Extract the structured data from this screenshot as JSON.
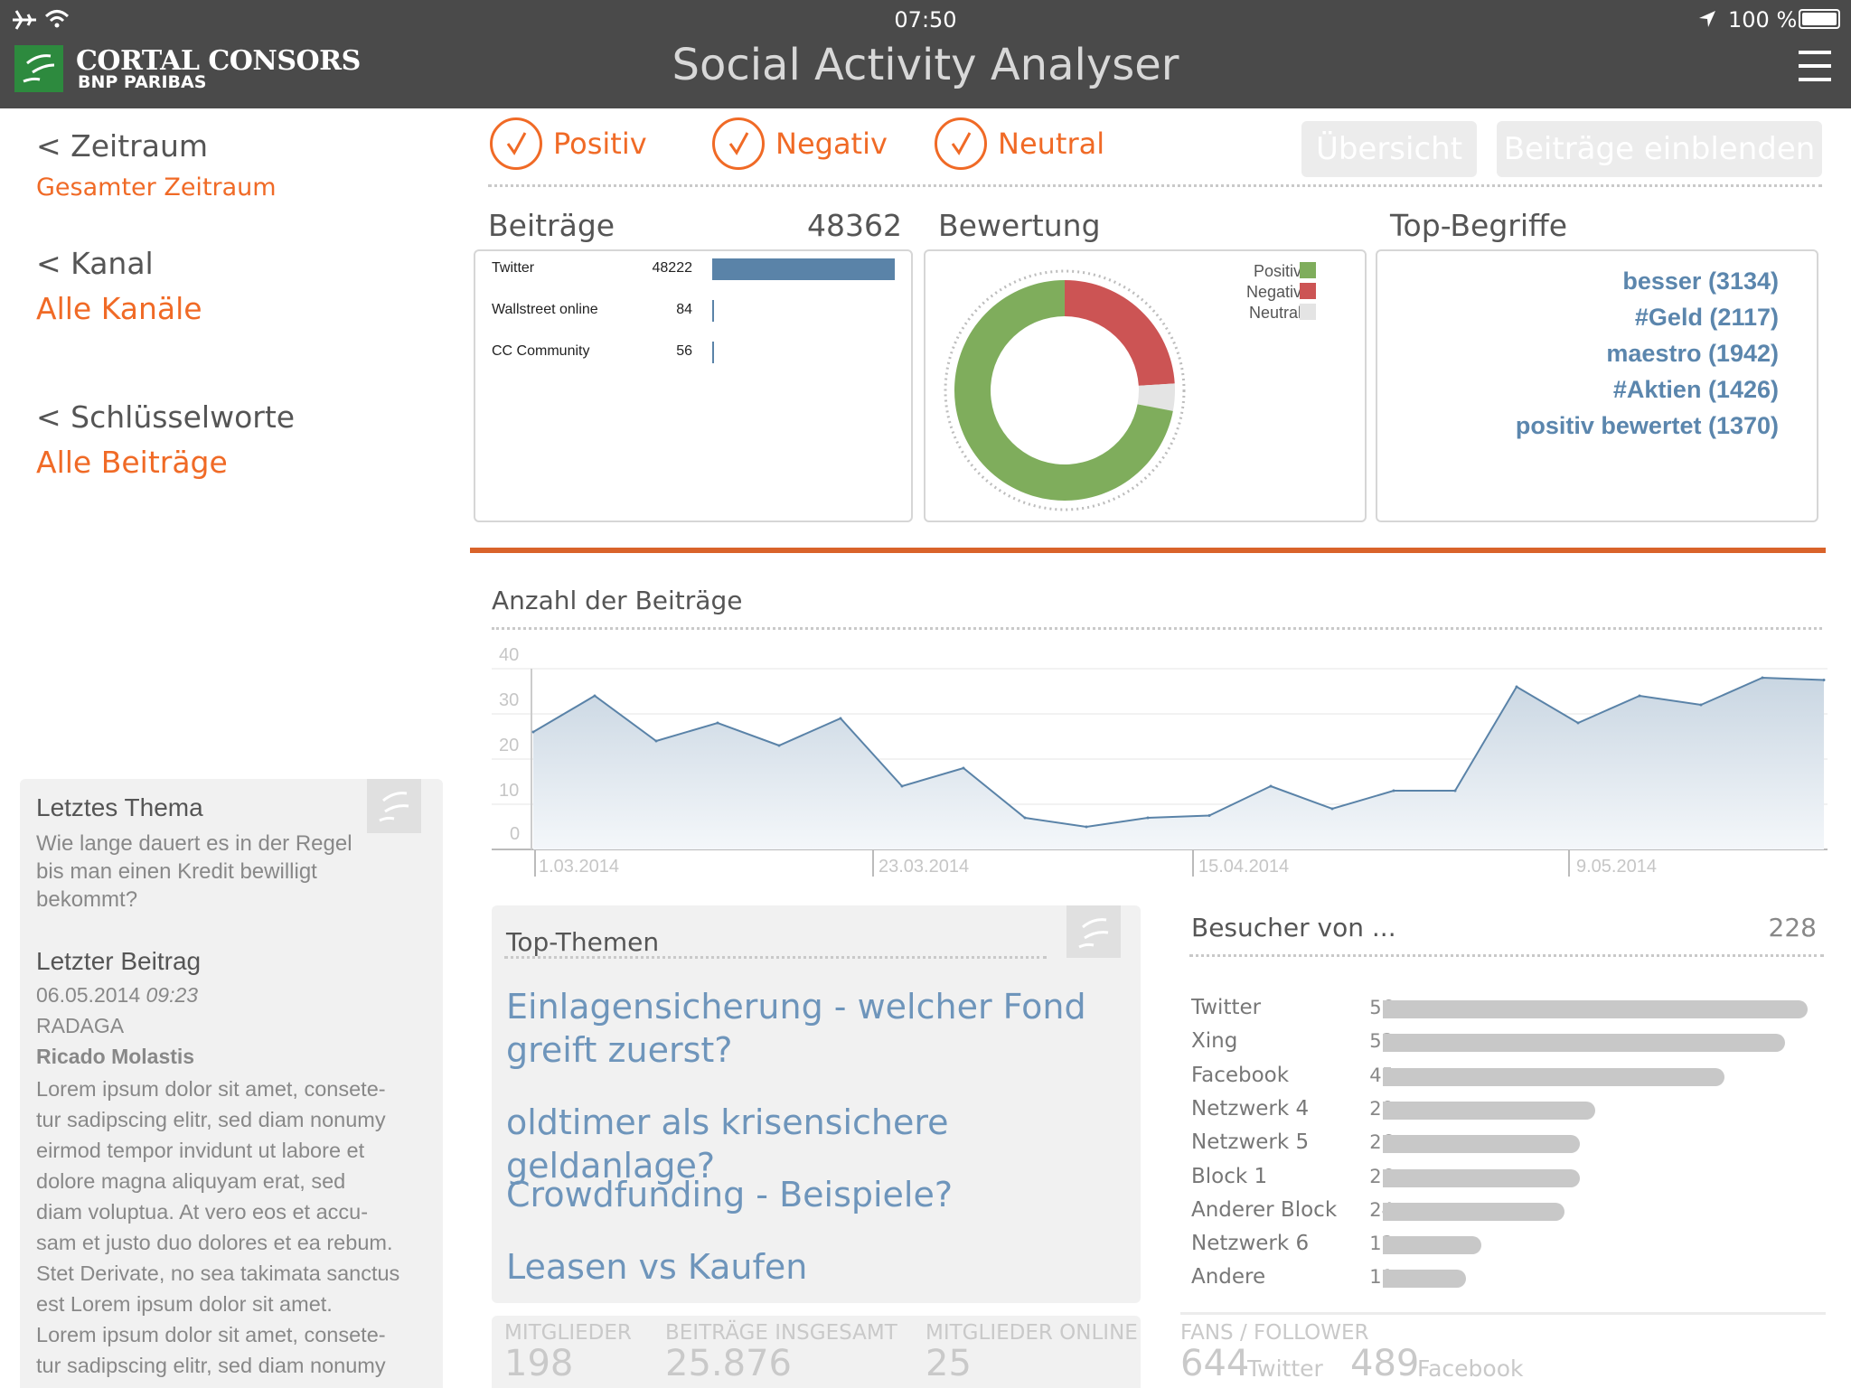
{
  "status": {
    "time": "07:50",
    "battery": "100 %"
  },
  "app": {
    "title": "Social Activity Analyser",
    "brand_line1": "CORTAL CONSORS",
    "brand_line2": "BNP PARIBAS"
  },
  "nav": {
    "zeitraum_label": "< Zeitraum",
    "zeitraum_value": "Gesamter Zeitraum",
    "kanal_label": "< Kanal",
    "kanal_value": "Alle Kanäle",
    "schluessel_label": "< Schlüsselworte",
    "schluessel_value": "Alle Beiträge"
  },
  "side_card": {
    "last_topic_title": "Letztes Thema",
    "last_topic_line1": "Wie lange dauert es in der Regel",
    "last_topic_line2": "bis man einen Kredit bewilligt",
    "last_topic_line3": "bekommt?",
    "last_post_title": "Letzter Beitrag",
    "last_post_date": "06.05.2014",
    "last_post_time": "09:23",
    "last_post_source": "RADAGA",
    "last_post_author": "Ricado Molastis",
    "body_lines": [
      "Lorem ipsum dolor sit amet, consete-",
      "tur sadipscing elitr, sed diam nonumy",
      "eirmod tempor invidunt ut labore et",
      "dolore magna aliquyam erat, sed",
      "diam voluptua. At vero eos et accu-",
      "sam et justo duo dolores et ea rebum.",
      "Stet Derivate, no sea takimata sanctus",
      "est Lorem ipsum dolor sit amet.",
      "Lorem ipsum dolor sit amet, consete-",
      "tur sadipscing elitr, sed diam nonumy"
    ]
  },
  "filters": {
    "positiv": "Positiv",
    "negativ": "Negativ",
    "neutral": "Neutral",
    "overview_button": "Übersicht",
    "show_posts_button": "Beiträge einblenden"
  },
  "beitraege": {
    "title": "Beiträge",
    "total": "48362",
    "rows": [
      {
        "label": "Twitter",
        "value": "48222",
        "fraction": 1.0
      },
      {
        "label": "Wallstreet online",
        "value": "84",
        "fraction": 0.002
      },
      {
        "label": "CC Community",
        "value": "56",
        "fraction": 0.001
      }
    ]
  },
  "bewertung": {
    "title": "Bewertung",
    "legend": [
      {
        "label": "Positiv",
        "color": "#7fad5c"
      },
      {
        "label": "Negativ",
        "color": "#cc5454"
      },
      {
        "label": "Neutral",
        "color": "#e4e4e4"
      }
    ],
    "shares": {
      "positiv": 0.72,
      "negativ": 0.24,
      "neutral": 0.04
    }
  },
  "top_begriffe": {
    "title": "Top-Begriffe",
    "items": [
      "besser (3134)",
      "#Geld (2117)",
      "maestro (1942)",
      "#Aktien (1426)",
      "positiv bewertet (1370)"
    ]
  },
  "chart_data": {
    "type": "area",
    "title": "Anzahl der Beiträge",
    "ylim": [
      0,
      40
    ],
    "yticks": [
      "40",
      "30",
      "20",
      "10",
      "0"
    ],
    "xtick_labels": [
      "1.03.2014",
      "23.03.2014",
      "15.04.2014",
      "9.05.2014"
    ],
    "values": [
      26,
      34,
      24,
      28,
      23,
      29,
      14,
      18,
      7,
      5,
      7,
      7.5,
      14,
      9,
      13,
      13,
      36,
      28,
      34,
      32,
      38,
      37.5
    ],
    "color": "#5a83a8"
  },
  "top_themen": {
    "title": "Top-Themen",
    "items": [
      "Einlagensicherung - welcher Fond greift zuerst?",
      "oldtimer als krisensichere geldanlage?",
      "Crowdfunding - Beispiele?",
      "Leasen vs Kaufen"
    ]
  },
  "besucher": {
    "title": "Besucher von ...",
    "total": "228",
    "rows": [
      {
        "label": "Twitter",
        "value": "56"
      },
      {
        "label": "Xing",
        "value": "53"
      },
      {
        "label": "Facebook",
        "value": "45"
      },
      {
        "label": "Netzwerk 4",
        "value": "28"
      },
      {
        "label": "Netzwerk 5",
        "value": "26"
      },
      {
        "label": "Block 1",
        "value": "26"
      },
      {
        "label": "Anderer Block",
        "value": "24"
      },
      {
        "label": "Netzwerk 6",
        "value": "13"
      },
      {
        "label": "Andere",
        "value": "11"
      }
    ]
  },
  "stats": {
    "mitglieder_label": "MITGLIEDER",
    "mitglieder_value": "198",
    "beitraege_label": "BEITRÄGE INSGESAMT",
    "beitraege_value": "25.876",
    "online_label": "MITGLIEDER ONLINE",
    "online_value": "25",
    "fans_label": "FANS / FOLLOWER",
    "fans_twitter_value": "644",
    "fans_twitter_label": "Twitter",
    "fans_facebook_value": "489",
    "fans_facebook_label": "Facebook"
  }
}
